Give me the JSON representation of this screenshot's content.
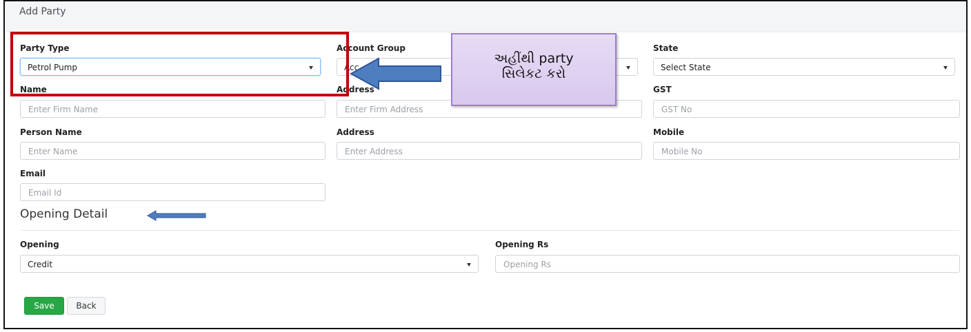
{
  "page": {
    "title": "Add Party"
  },
  "form": {
    "party_type": {
      "label": "Party Type",
      "value": "Petrol Pump"
    },
    "account_group": {
      "label": "Account Group",
      "value": "Acc"
    },
    "state": {
      "label": "State",
      "value": "Select State"
    },
    "name": {
      "label": "Name",
      "placeholder": "Enter Firm Name"
    },
    "firm_address": {
      "label": "Address",
      "placeholder": "Enter Firm Address"
    },
    "gst": {
      "label": "GST",
      "placeholder": "GST No"
    },
    "person_name": {
      "label": "Person Name",
      "placeholder": "Enter Name"
    },
    "address": {
      "label": "Address",
      "placeholder": "Enter Address"
    },
    "mobile": {
      "label": "Mobile",
      "placeholder": "Mobile No"
    },
    "email": {
      "label": "Email",
      "placeholder": "Email Id"
    }
  },
  "opening": {
    "section_title": "Opening Detail",
    "opening": {
      "label": "Opening",
      "value": "Credit"
    },
    "opening_rs": {
      "label": "Opening Rs",
      "placeholder": "Opening Rs"
    }
  },
  "actions": {
    "save_label": "Save",
    "back_label": "Back"
  },
  "annotation": {
    "callout_line1": "અહીંથી party",
    "callout_line2": "સિલેકટ કરો",
    "highlight_color": "#c0000b",
    "arrow_color": "#4f7ec0"
  },
  "colors": {
    "save_button": "#28a745",
    "focus_border": "#80bdff"
  }
}
